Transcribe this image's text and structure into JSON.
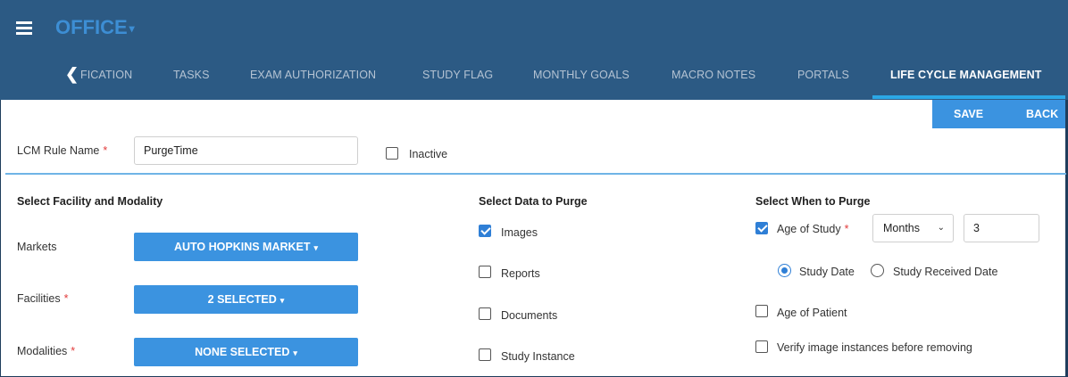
{
  "header": {
    "app_title": "OFFICE",
    "app_caret": "▾",
    "back_nav": "❮",
    "tabs": [
      {
        "label": "FICATION"
      },
      {
        "label": "TASKS"
      },
      {
        "label": "EXAM AUTHORIZATION"
      },
      {
        "label": "STUDY FLAG"
      },
      {
        "label": "MONTHLY GOALS"
      },
      {
        "label": "MACRO NOTES"
      },
      {
        "label": "PORTALS"
      },
      {
        "label": "LIFE CYCLE MANAGEMENT",
        "active": true
      }
    ]
  },
  "toolbar": {
    "save_label": "SAVE",
    "back_label": "BACK"
  },
  "rule": {
    "name_label": "LCM Rule Name",
    "required_mark": "*",
    "name_value": "PurgeTime",
    "inactive_label": "Inactive"
  },
  "facility": {
    "heading": "Select Facility and Modality",
    "markets_label": "Markets",
    "markets_value": "AUTO HOPKINS MARKET",
    "facilities_label": "Facilities",
    "facilities_value": "2 SELECTED",
    "modalities_label": "Modalities",
    "modalities_value": "NONE SELECTED",
    "caret": "▾"
  },
  "purge_data": {
    "heading": "Select Data to Purge",
    "items": [
      {
        "label": "Images",
        "checked": true
      },
      {
        "label": "Reports",
        "checked": false
      },
      {
        "label": "Documents",
        "checked": false
      },
      {
        "label": "Study Instance",
        "checked": false
      }
    ]
  },
  "purge_when": {
    "heading": "Select When to Purge",
    "age_of_study_label": "Age of Study",
    "age_of_study_checked": true,
    "unit_value": "Months",
    "unit_chevron": "⌄",
    "amount_value": "3",
    "radio_study_date": "Study Date",
    "radio_received_date": "Study Received Date",
    "age_of_patient_label": "Age of Patient",
    "verify_label": "Verify image instances before removing"
  },
  "colors": {
    "header_bg": "#2c5a84",
    "accent": "#3b93e0",
    "tab_underline": "#2ca8e6",
    "required": "#e23b3b"
  }
}
